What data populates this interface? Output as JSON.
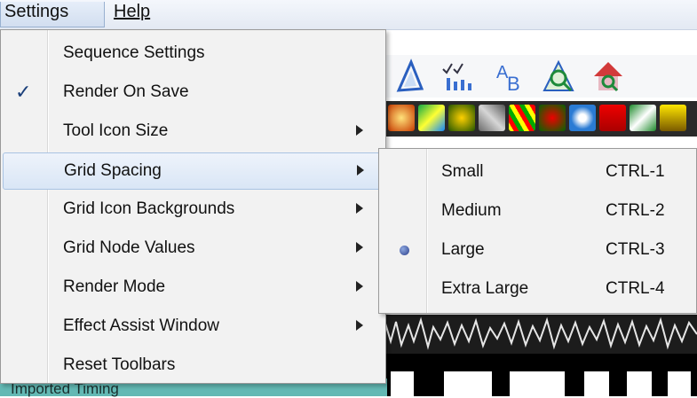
{
  "menubar": {
    "settings": "Settings",
    "help": "Help"
  },
  "settings_menu": {
    "items": [
      {
        "label": "Sequence Settings",
        "checked": false,
        "submenu": false
      },
      {
        "label": "Render On Save",
        "checked": true,
        "submenu": false
      },
      {
        "label": "Tool Icon Size",
        "checked": false,
        "submenu": true
      },
      {
        "label": "Grid Spacing",
        "checked": false,
        "submenu": true,
        "active": true
      },
      {
        "label": "Grid Icon Backgrounds",
        "checked": false,
        "submenu": true
      },
      {
        "label": "Grid Node Values",
        "checked": false,
        "submenu": true
      },
      {
        "label": "Render Mode",
        "checked": false,
        "submenu": true
      },
      {
        "label": "Effect Assist Window",
        "checked": false,
        "submenu": true
      },
      {
        "label": "Reset Toolbars",
        "checked": false,
        "submenu": false
      }
    ],
    "check_glyph": "✓"
  },
  "grid_spacing_submenu": {
    "items": [
      {
        "label": "Small",
        "shortcut": "CTRL-1",
        "selected": false
      },
      {
        "label": "Medium",
        "shortcut": "CTRL-2",
        "selected": false
      },
      {
        "label": "Large",
        "shortcut": "CTRL-3",
        "selected": true
      },
      {
        "label": "Extra Large",
        "shortcut": "CTRL-4",
        "selected": false
      }
    ]
  },
  "background": {
    "status_text": "Imported Timing",
    "toolbar_icons": [
      "triangle-tool-icon",
      "checklist-tool-icon",
      "text-tool-icon",
      "magnify-tool-icon",
      "house-tool-icon"
    ]
  },
  "colors": {
    "menu_bg": "#f2f2f2",
    "highlight": "#d9e6f6",
    "status_strip": "#63b9b4"
  }
}
